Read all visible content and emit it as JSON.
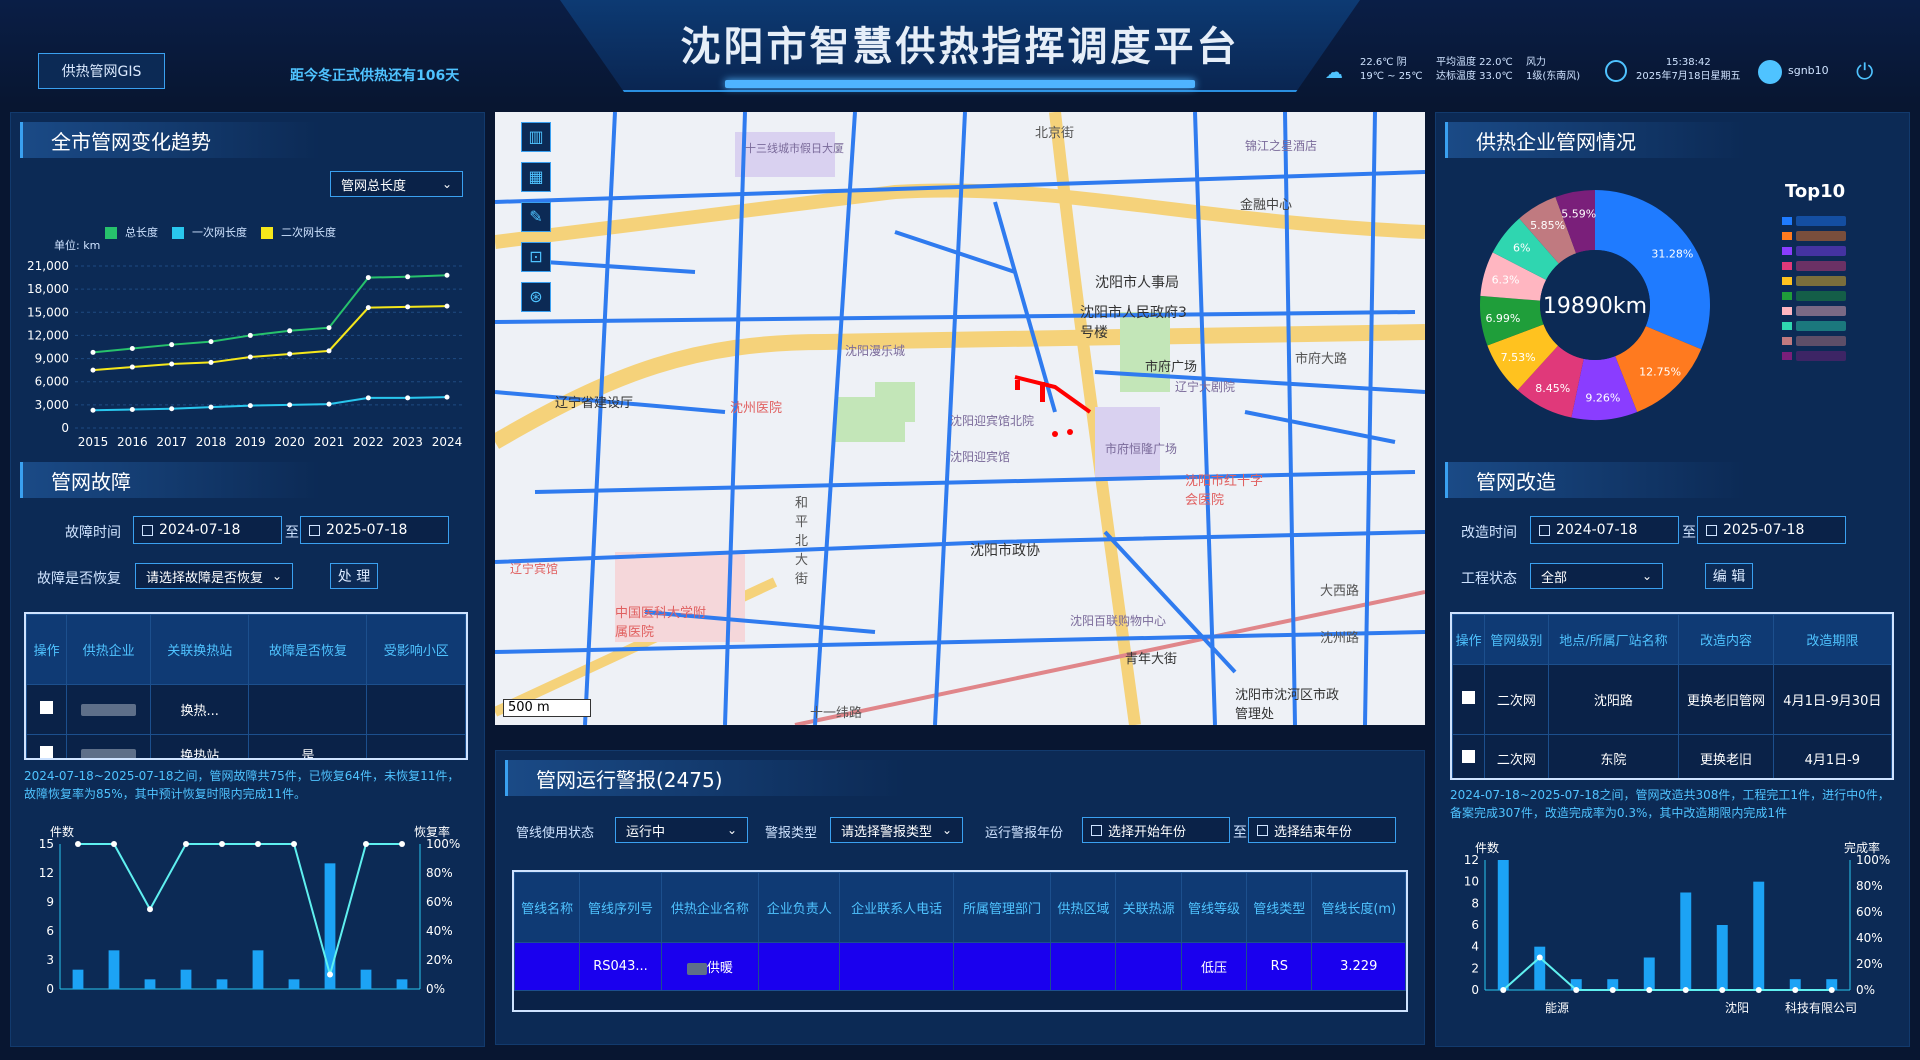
{
  "header": {
    "title": "沈阳市智慧供热指挥调度平台",
    "gis_button": "供热管网GIS",
    "countdown": "距今冬正式供热还有106天",
    "weather": {
      "temp_now": "22.6℃ 阴",
      "temp_range": "19℃ ~ 25℃",
      "avg_temp": "平均温度 22.0℃",
      "reach_temp": "达标温度 33.0℃",
      "wind_label": "风力",
      "wind_level": "1级(东南风)"
    },
    "time": "15:38:42",
    "date": "2025年7月18日星期五",
    "user": "sgnb10"
  },
  "trend": {
    "title": "全市管网变化趋势",
    "select": "管网总长度",
    "unit": "单位: km",
    "legend": [
      {
        "name": "总长度",
        "color": "#27c26c"
      },
      {
        "name": "一次网长度",
        "color": "#29c7ee"
      },
      {
        "name": "二次网长度",
        "color": "#f5e71b"
      }
    ]
  },
  "chart_data": [
    {
      "type": "line",
      "x": [
        "2015",
        "2016",
        "2017",
        "2018",
        "2019",
        "2020",
        "2021",
        "2022",
        "2023",
        "2024"
      ],
      "series": [
        {
          "name": "总长度",
          "values": [
            9800,
            10300,
            10800,
            11200,
            12000,
            12600,
            13000,
            19500,
            19600,
            19800
          ]
        },
        {
          "name": "一次网长度",
          "values": [
            2300,
            2400,
            2500,
            2700,
            2900,
            3000,
            3100,
            3900,
            3900,
            4000
          ]
        },
        {
          "name": "二次网长度",
          "values": [
            7500,
            7900,
            8300,
            8500,
            9200,
            9600,
            10000,
            15600,
            15700,
            15800
          ]
        }
      ],
      "ylim": [
        0,
        21000
      ],
      "yticks": [
        "21,000",
        "18,000",
        "15,000",
        "12,000",
        "9,000",
        "6,000",
        "3,000",
        "0"
      ]
    },
    {
      "type": "bar",
      "ylabel": "件数",
      "y2label": "恢复率",
      "values": [
        2,
        4,
        1,
        2,
        1,
        4,
        1,
        13,
        2,
        1
      ],
      "rate": [
        100,
        100,
        55,
        100,
        100,
        100,
        100,
        10,
        100,
        100
      ],
      "ylim": [
        0,
        15
      ],
      "yticks": [
        "15",
        "12",
        "9",
        "6",
        "3",
        "0"
      ],
      "y2ticks": [
        "100%",
        "80%",
        "60%",
        "40%",
        "20%",
        "0%"
      ]
    },
    {
      "type": "bar",
      "ylabel": "件数",
      "y2label": "完成率",
      "values": [
        12,
        4,
        1,
        1,
        3,
        9,
        6,
        10,
        1,
        1
      ],
      "rate": [
        0,
        25,
        0,
        0,
        0,
        0,
        0,
        0,
        0,
        0
      ],
      "ylim": [
        0,
        12
      ],
      "yticks": [
        "12",
        "10",
        "8",
        "6",
        "4",
        "2",
        "0"
      ],
      "y2ticks": [
        "100%",
        "80%",
        "60%",
        "40%",
        "20%",
        "0%"
      ],
      "xlabels": [
        "能源",
        "沈阳",
        "科技有限公司"
      ]
    },
    {
      "type": "pie",
      "center": "19890km",
      "title": "Top10",
      "values": [
        31.28,
        12.75,
        9.26,
        8.45,
        7.53,
        6.99,
        6.3,
        6,
        5.85,
        5.59
      ],
      "labels": [
        "31.28%",
        "12.75%",
        "9.26%",
        "8.45%",
        "7.53%",
        "6.99%",
        "6.3%",
        "6%",
        "5.85%",
        "5.59%"
      ],
      "colors": [
        "#1f7bff",
        "#ff7a1f",
        "#8a3dff",
        "#e0397a",
        "#ffc21f",
        "#1f9e3a",
        "#ffb6c1",
        "#2fd6b0",
        "#c07a80",
        "#7a1f7a"
      ]
    }
  ],
  "fault": {
    "title": "管网故障",
    "time_label": "故障时间",
    "date_from": "2024-07-18",
    "to": "至",
    "date_to": "2025-07-18",
    "recover_label": "故障是否恢复",
    "recover_placeholder": "请选择故障是否恢复",
    "process_btn": "处 理",
    "columns": [
      "操作",
      "供热企业",
      "关联换热站",
      "故障是否恢复",
      "受影响小区"
    ],
    "rows": [
      {
        "station": "换热..."
      },
      {
        "station": "换热站",
        "status": "是"
      }
    ],
    "summary": "2024-07-18~2025-07-18之间，管网故障共75件，已恢复64件，未恢复11件，故障恢复率为85%，其中预计恢复时限内完成11件。"
  },
  "map": {
    "scale": "500 m",
    "places": [
      "十三线城市假日大厦",
      "北京街",
      "锦江之星酒店",
      "金融中心",
      "沈阳市人事局",
      "沈阳市人民政府3号楼",
      "沈阳漫乐城",
      "市府广场",
      "市府大路",
      "辽宁省建设厅",
      "沈州医院",
      "辽宁大剧院",
      "沈阳迎宾馆北院",
      "沈阳迎宾馆",
      "市府恒隆广场",
      "沈阳市红十字会医院",
      "和平北大街",
      "辽宁宾馆",
      "沈阳市政协",
      "中国医科大学附属医院",
      "沈阳百联购物中心",
      "青年大街",
      "十一纬路",
      "大西路",
      "沈州路",
      "沈阳市沈河区市政管理处"
    ]
  },
  "alarm": {
    "title": "管网运行警报(2475)",
    "status_label": "管线使用状态",
    "status_value": "运行中",
    "type_label": "警报类型",
    "type_placeholder": "请选择警报类型",
    "year_label": "运行警报年份",
    "year_from": "选择开始年份",
    "to": "至",
    "year_to": "选择结束年份",
    "columns": [
      "管线名称",
      "管线序列号",
      "供热企业名称",
      "企业负责人",
      "企业联系人电话",
      "所属管理部门",
      "供热区域",
      "关联热源",
      "管线等级",
      "管线类型",
      "管线长度(m)"
    ],
    "row": {
      "serial": "RS043...",
      "company": "供暖",
      "grade": "低压",
      "type": "RS",
      "length": "3.229"
    }
  },
  "enterprise": {
    "title": "供热企业管网情况"
  },
  "renov": {
    "title": "管网改造",
    "time_label": "改造时间",
    "date_from": "2024-07-18",
    "to": "至",
    "date_to": "2025-07-18",
    "status_label": "工程状态",
    "status_value": "全部",
    "edit_btn": "编 辑",
    "columns": [
      "操作",
      "管网级别",
      "地点/所属厂站名称",
      "改造内容",
      "改造期限"
    ],
    "rows": [
      {
        "level": "二次网",
        "place": "沈阳路",
        "content": "更换老旧管网",
        "period": "4月1日-9月30日"
      },
      {
        "level": "二次网",
        "place": "东院",
        "content": "更换老旧",
        "period": "4月1日-9"
      }
    ],
    "summary": "2024-07-18~2025-07-18之间，管网改造共308件，工程完工1件，进行中0件，备案完成307件，改造完成率为0.3%，其中改造期限内完成1件"
  }
}
